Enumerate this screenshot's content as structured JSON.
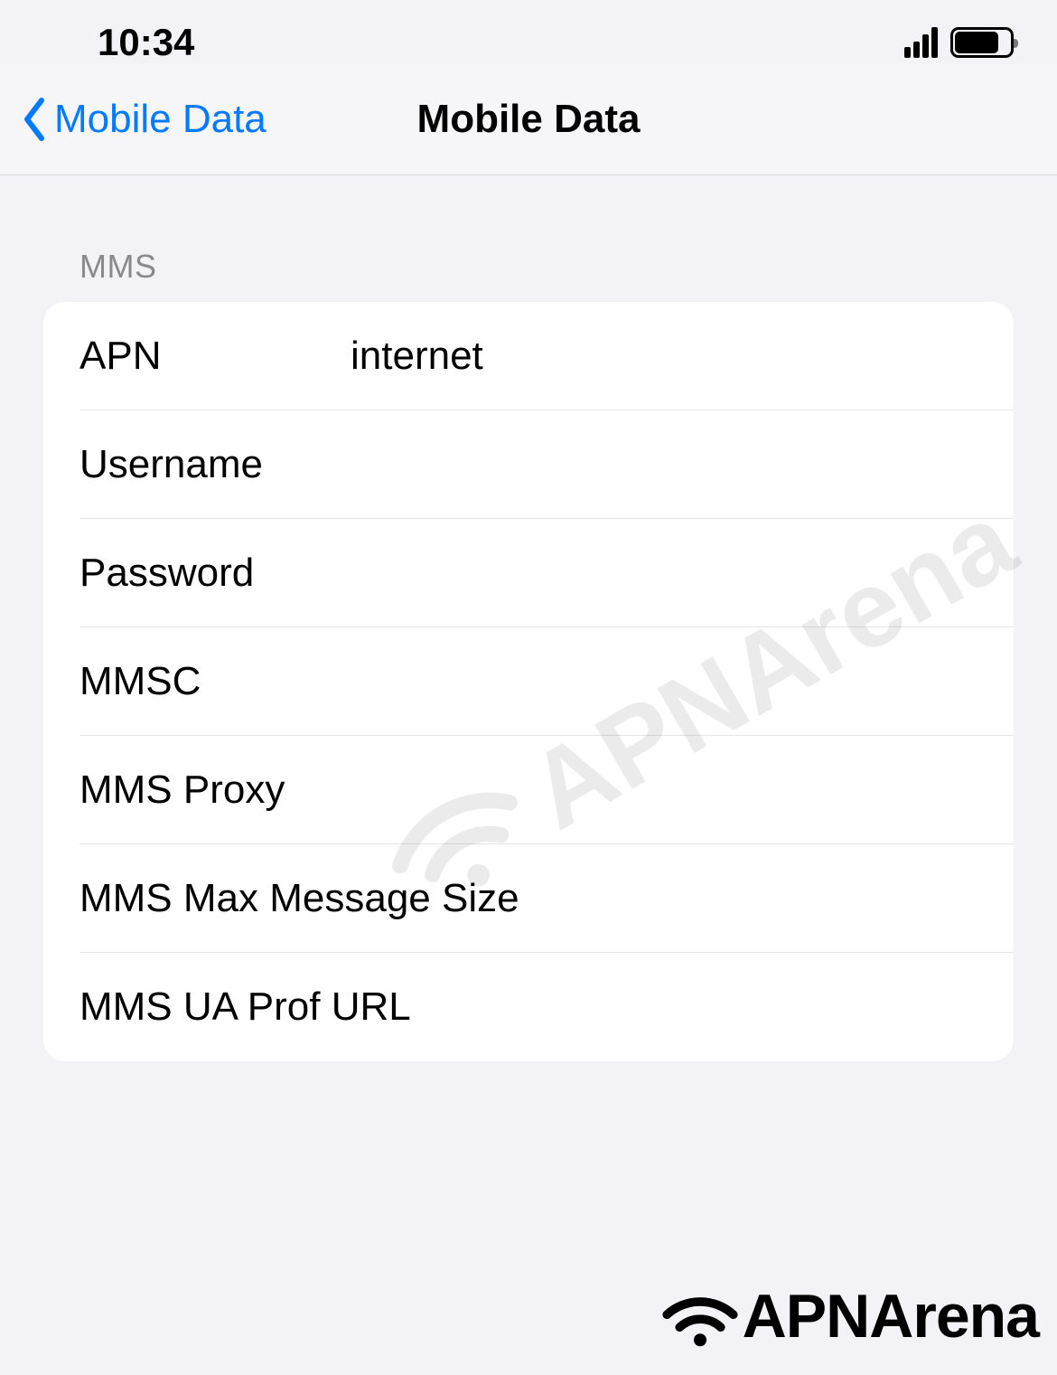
{
  "status": {
    "time": "10:34"
  },
  "nav": {
    "back_label": "Mobile Data",
    "title": "Mobile Data"
  },
  "section_header": "MMS",
  "fields": {
    "apn": {
      "label": "APN",
      "value": "internet"
    },
    "username": {
      "label": "Username",
      "value": ""
    },
    "password": {
      "label": "Password",
      "value": ""
    },
    "mmsc": {
      "label": "MMSC",
      "value": ""
    },
    "mms_proxy": {
      "label": "MMS Proxy",
      "value": ""
    },
    "mms_max_size": {
      "label": "MMS Max Message Size",
      "value": ""
    },
    "mms_ua_prof": {
      "label": "MMS UA Prof URL",
      "value": ""
    }
  },
  "watermark": "APNArena",
  "brand": "APNArena"
}
